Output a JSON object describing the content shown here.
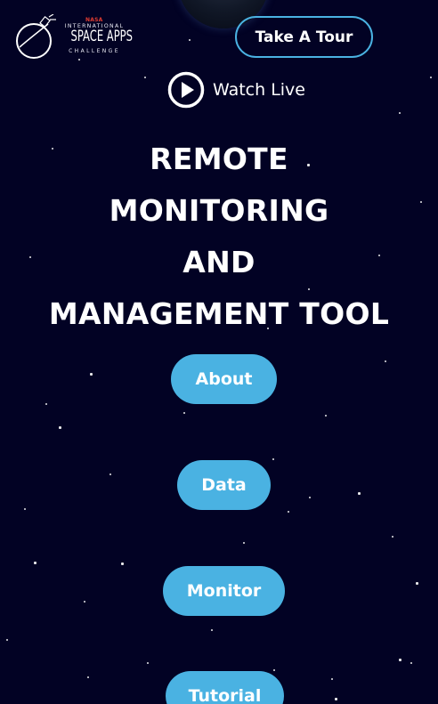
{
  "logo": {
    "agency": "NASA",
    "line1": "INTERNATIONAL",
    "line2": "SPACE APPS",
    "line3": "CHALLENGE"
  },
  "header": {
    "tour_button_label": "Take A Tour",
    "watch_live_label": "Watch Live"
  },
  "hero": {
    "title_lines": [
      "REMOTE",
      "MONITORING",
      "AND",
      "MANAGEMENT TOOL"
    ]
  },
  "nav": {
    "about": "About",
    "data": "Data",
    "monitor": "Monitor",
    "tutorial": "Tutorial"
  },
  "colors": {
    "background": "#020224",
    "accent": "#4ab2e2",
    "nasa_red": "#e03c31",
    "text": "#ffffff"
  },
  "icons": {
    "logo_mark": "satellite-orbit-icon",
    "watch_live": "play-circle-icon"
  }
}
